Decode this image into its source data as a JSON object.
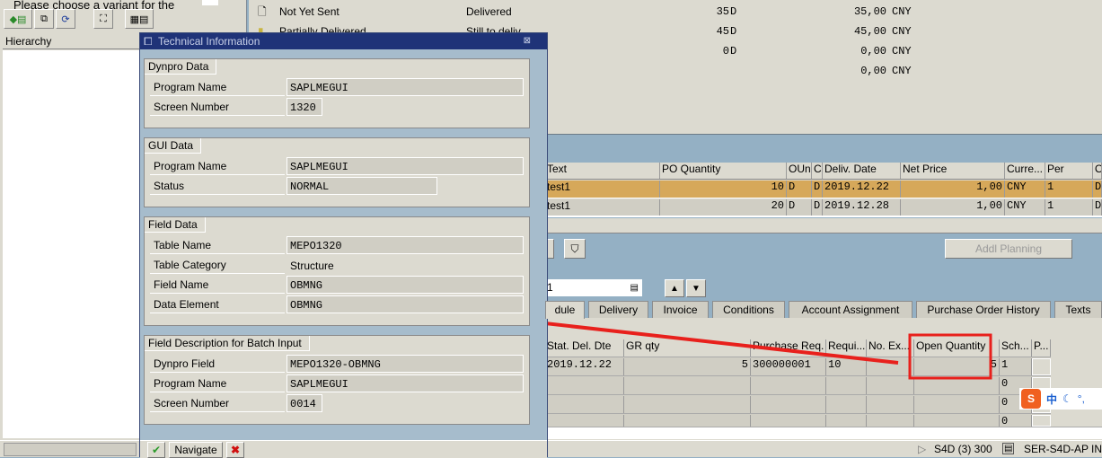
{
  "left": {
    "variant_text": "Please choose a variant for the",
    "hierarchy_label": "Hierarchy"
  },
  "top_status": {
    "rows": [
      {
        "label": "Not Yet Sent",
        "status": "Delivered",
        "qty": "35",
        "unit": "D",
        "amount": "35,00",
        "cur": "CNY"
      },
      {
        "label": "Partially Delivered",
        "status": "Still to deliv",
        "qty": "45",
        "unit": "D",
        "amount": "45,00",
        "cur": "CNY"
      },
      {
        "label": "",
        "status": "",
        "qty": "0",
        "unit": "D",
        "amount": "0,00",
        "cur": "CNY"
      },
      {
        "label": "",
        "status": "",
        "qty": "",
        "unit": "",
        "amount": "0,00",
        "cur": "CNY"
      }
    ]
  },
  "items_table": {
    "headers": [
      "Text",
      "PO Quantity",
      "OUn",
      "C",
      "Deliv. Date",
      "Net Price",
      "Curre...",
      "Per",
      "O"
    ],
    "rows": [
      [
        "test1",
        "10",
        "D",
        "D",
        "2019.12.22",
        "1,00",
        "CNY",
        "1",
        "D"
      ],
      [
        "test1",
        "20",
        "D",
        "D",
        "2019.12.28",
        "1,00",
        "CNY",
        "1",
        "D"
      ]
    ]
  },
  "addl_planning": "Addl Planning",
  "item_select_value": "1",
  "tabs": [
    "dule",
    "Delivery",
    "Invoice",
    "Conditions",
    "Account Assignment",
    "Purchase Order History",
    "Texts"
  ],
  "schedule_table": {
    "headers": [
      "Stat. Del. Dte",
      "GR qty",
      "Purchase Req.",
      "Requi...",
      "No. Ex...",
      "Open Quantity",
      "Sch...",
      "P..."
    ],
    "rows": [
      [
        "2019.12.22",
        "5",
        "300000001",
        "10",
        "",
        "5",
        "1"
      ],
      [
        "",
        "",
        "",
        "",
        "",
        "",
        "0"
      ],
      [
        "",
        "",
        "",
        "",
        "",
        "",
        "0"
      ],
      [
        "",
        "",
        "",
        "",
        "",
        "",
        "0"
      ]
    ]
  },
  "ime": {
    "lang": "中"
  },
  "status_bar": {
    "system": "S4D (3) 300",
    "server": "SER-S4D-AP",
    "mode": "IN"
  },
  "dialog": {
    "title": "Technical Information",
    "dynpro": {
      "title": "Dynpro Data",
      "program_label": "Program Name",
      "program": "SAPLMEGUI",
      "screen_label": "Screen Number",
      "screen": "1320"
    },
    "gui": {
      "title": "GUI Data",
      "program_label": "Program Name",
      "program": "SAPLMEGUI",
      "status_label": "Status",
      "status": "NORMAL"
    },
    "field": {
      "title": "Field Data",
      "table_label": "Table Name",
      "table": "MEPO1320",
      "category_label": "Table Category",
      "category": "Structure",
      "field_label": "Field Name",
      "field": "OBMNG",
      "element_label": "Data Element",
      "element": "OBMNG"
    },
    "batch": {
      "title": "Field Description for Batch Input",
      "dynpro_label": "Dynpro Field",
      "dynpro": "MEPO1320-OBMNG",
      "program_label": "Program Name",
      "program": "SAPLMEGUI",
      "screen_label": "Screen Number",
      "screen": "0014"
    },
    "navigate_label": "Navigate"
  },
  "colors": {
    "highlight_row": "#d6a85a",
    "annotation": "#e8201c",
    "title_bar": "#1f3378"
  }
}
